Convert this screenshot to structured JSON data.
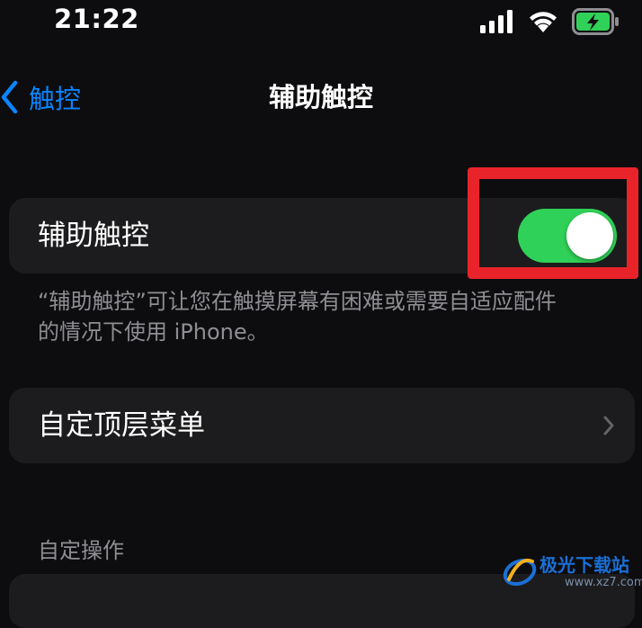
{
  "status_bar": {
    "time": "21:22",
    "signal_icon": "cellular-signal-icon",
    "wifi_icon": "wifi-icon",
    "battery_icon": "battery-charging-icon"
  },
  "nav": {
    "back_label": "触控",
    "title": "辅助触控"
  },
  "toggle_row": {
    "label": "辅助触控",
    "enabled": true
  },
  "footnote": {
    "line1": "“辅助触控”可让您在触摸屏幕有困难或需要自适应配件",
    "line2": "的情况下使用 iPhone。"
  },
  "menu_row": {
    "label": "自定顶层菜单"
  },
  "section": {
    "header": "自定操作"
  },
  "watermark": {
    "title": "极光下载站",
    "url": "www.xz7.com"
  },
  "colors": {
    "background": "#0d0d0f",
    "card": "#1c1c1e",
    "accent_blue": "#0a84ff",
    "toggle_green": "#30d158",
    "highlight_red": "#e8242a",
    "secondary_text": "#8e8e93"
  }
}
